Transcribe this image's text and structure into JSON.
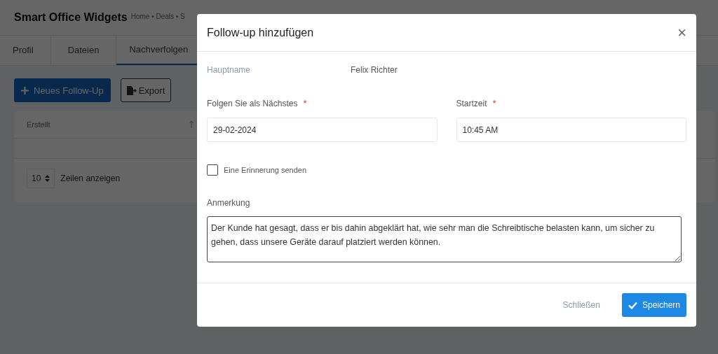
{
  "page": {
    "title": "Smart Office Widgets",
    "breadcrumb": "Home • Deals • S",
    "tabs": [
      {
        "label": "Profil",
        "selected": false
      },
      {
        "label": "Dateien",
        "selected": false
      },
      {
        "label": "Nachverfolgen",
        "selected": true
      }
    ],
    "new_button": "Neues Follow-Up",
    "export_button": "Export",
    "table": {
      "columns": [
        "Erstellt"
      ],
      "page_size": "10",
      "page_size_label": "Zeilen anzeigen"
    }
  },
  "modal": {
    "title": "Follow-up hinzufügen",
    "close": "×",
    "main_name_label": "Hauptname",
    "main_name_value": "Felix Richter",
    "fields": [
      {
        "label": "Folgen Sie als Nächstes",
        "required_mark": "*",
        "value": "29-02-2024"
      },
      {
        "label": "Startzeit",
        "required_mark": "*",
        "value": "10:45 AM"
      }
    ],
    "reminder": {
      "label": "Eine Erinnerung senden",
      "checked": false
    },
    "note_label": "Anmerkung",
    "note_value": "Der Kunde hat gesagt, dass er bis dahin abgeklärt hat, wie sehr man die Schreibtische belasten kann, um sicher zu gehen, dass unsere Geräte darauf platziert werden können.",
    "close_button": "Schließen",
    "save_button": "Speichern"
  }
}
